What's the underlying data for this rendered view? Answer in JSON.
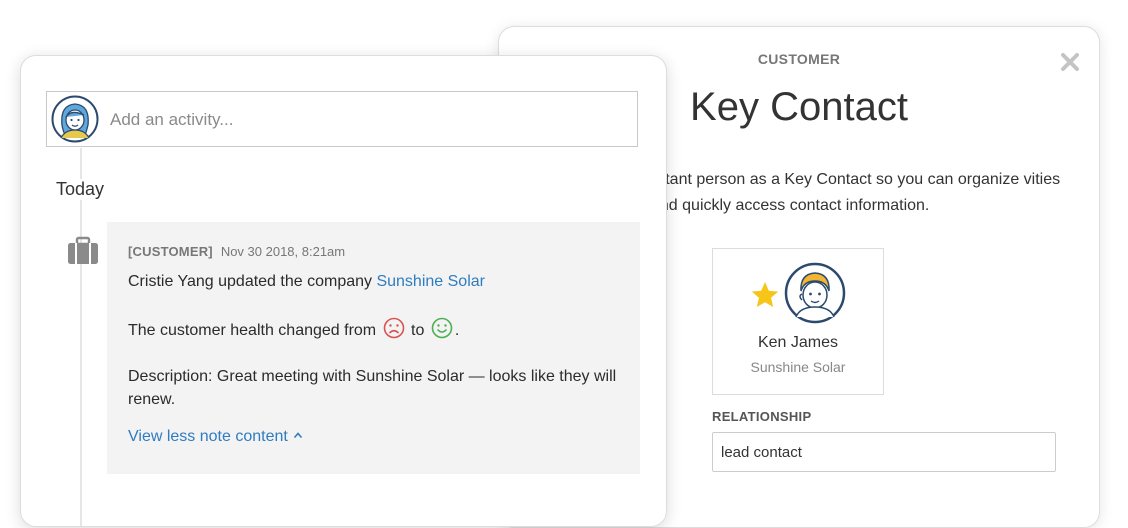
{
  "modal": {
    "eyebrow": "CUSTOMER",
    "title": "Key Contact",
    "description": "ortant person as a Key Contact so you can organize vities and quickly access contact information.",
    "contact": {
      "name": "Ken James",
      "company": "Sunshine Solar"
    },
    "relationship_label": "RELATIONSHIP",
    "relationship_value": "lead contact"
  },
  "feed": {
    "activity_placeholder": "Add an activity...",
    "section_label": "Today",
    "note": {
      "tag": "[CUSTOMER]",
      "date": "Nov 30 2018, 8:21am",
      "update_prefix": "Cristie Yang updated the company ",
      "company_link": "Sunshine Solar",
      "health_prefix": "The customer health changed from ",
      "health_mid": " to ",
      "health_suffix": ".",
      "description": "Description: Great meeting with Sunshine Solar — looks like they will renew.",
      "view_less": "View less note content"
    }
  },
  "colors": {
    "link": "#2f7cc0",
    "sad_face": "#d9534f",
    "happy_face": "#4caf50",
    "star": "#f5c518"
  }
}
